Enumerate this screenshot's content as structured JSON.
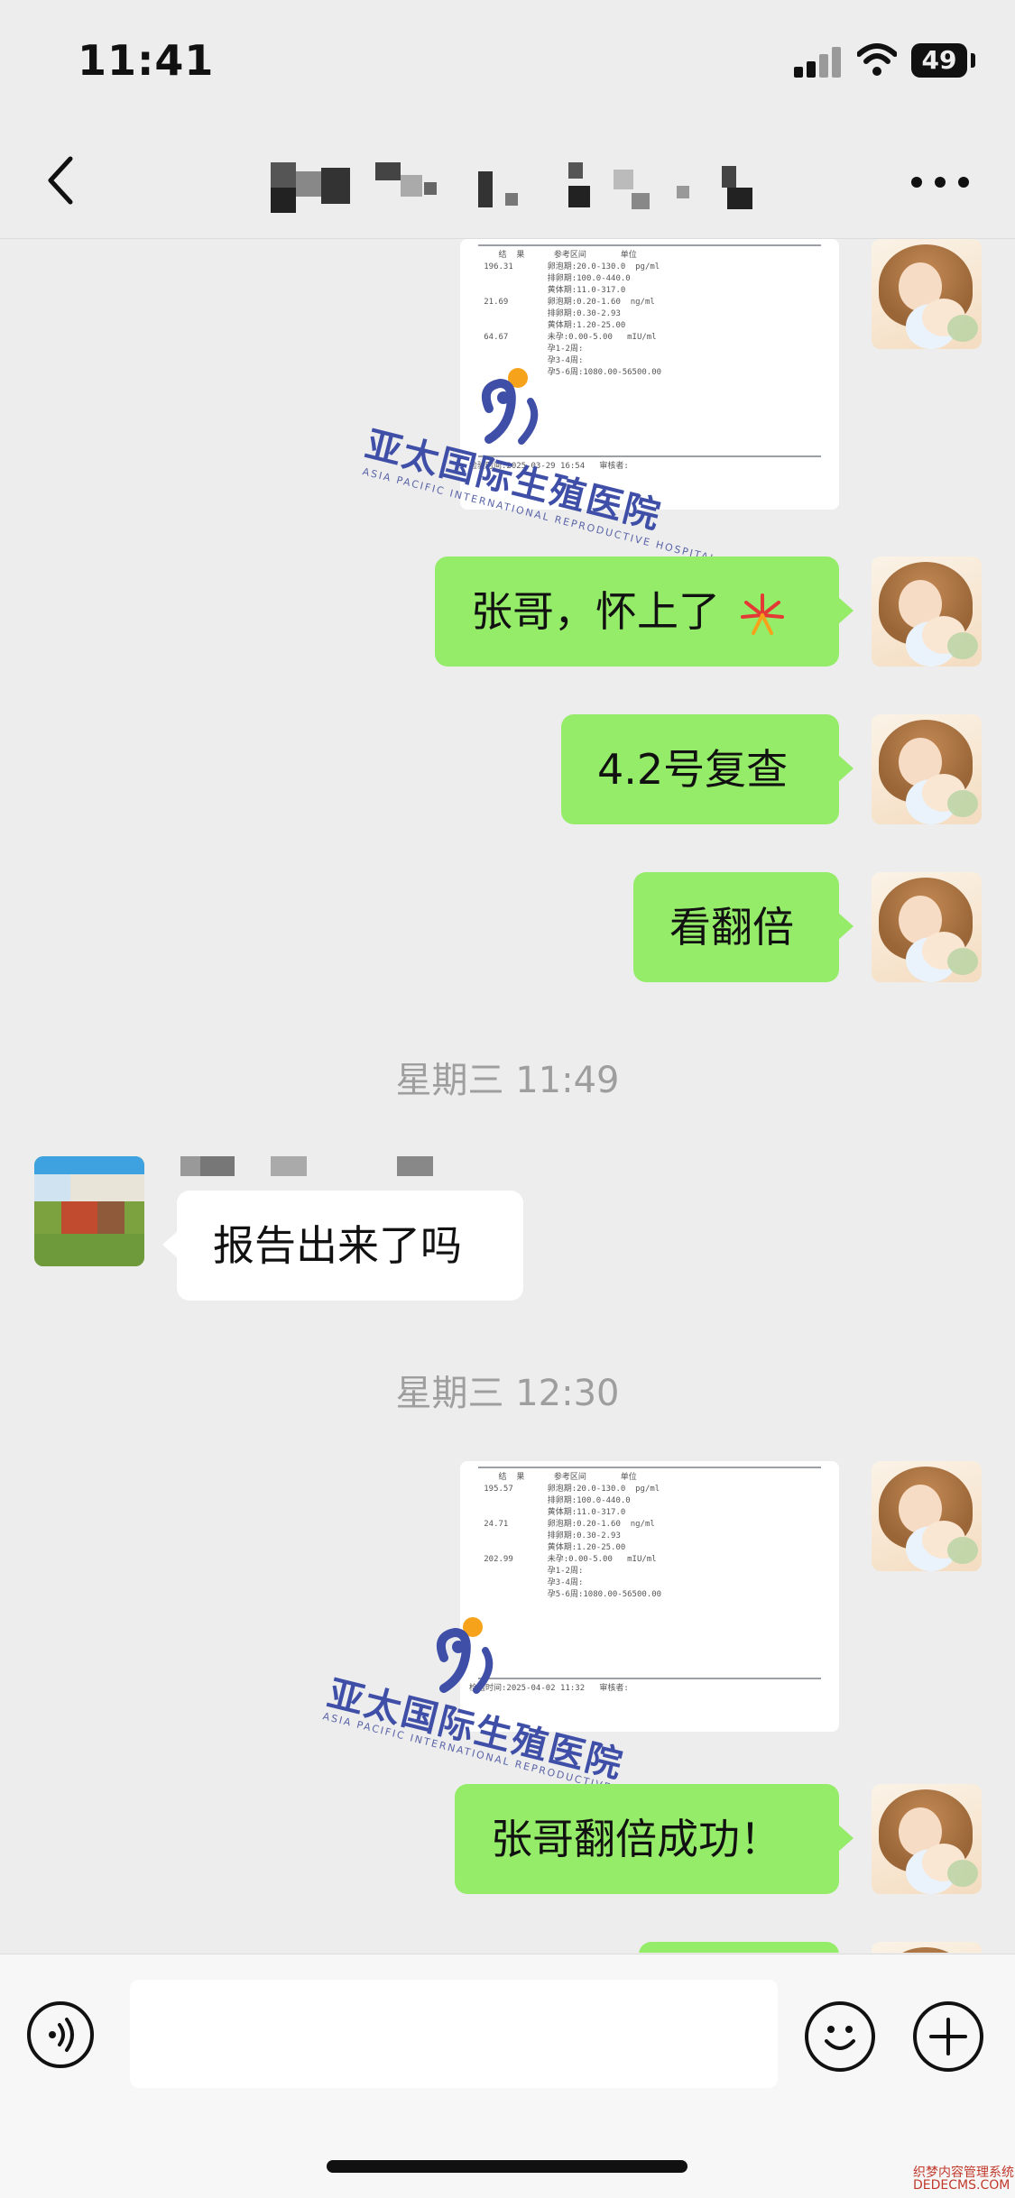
{
  "status_bar": {
    "time": "11:41",
    "battery": "49"
  },
  "chat_header": {
    "title": "redacted (pixelated)"
  },
  "messages": [
    {
      "type": "image",
      "sender": "me",
      "content": "lab report photo",
      "watermark": "亚太国际生殖医院",
      "watermark_en": "ASIA PACIFIC INTERNATIONAL REPRODUCTIVE HOSPITAL"
    },
    {
      "type": "text",
      "sender": "me",
      "text": "张哥，怀上了",
      "emoji": "fireworks"
    },
    {
      "type": "text",
      "sender": "me",
      "text": "4.2号复查"
    },
    {
      "type": "text",
      "sender": "me",
      "text": "看翻倍"
    },
    {
      "type": "time",
      "text": "星期三 11:49"
    },
    {
      "type": "text",
      "sender": "other",
      "text": "报告出来了吗"
    },
    {
      "type": "time",
      "text": "星期三 12:30"
    },
    {
      "type": "image",
      "sender": "me",
      "content": "lab report photo",
      "watermark": "亚太国际生殖医院",
      "watermark_en": "ASIA PACIFIC INTERNATIONAL REPRODUCTIVE HOSPITAL"
    },
    {
      "type": "text",
      "sender": "me",
      "text": "张哥翻倍成功！"
    }
  ],
  "input": {
    "value": ""
  },
  "corner_watermark": {
    "line1": "织梦内容管理系统",
    "line2": "DEDECMS.COM"
  },
  "colors": {
    "bubble_me": "#95ec69",
    "bubble_other": "#ffffff",
    "background": "#ededed"
  }
}
